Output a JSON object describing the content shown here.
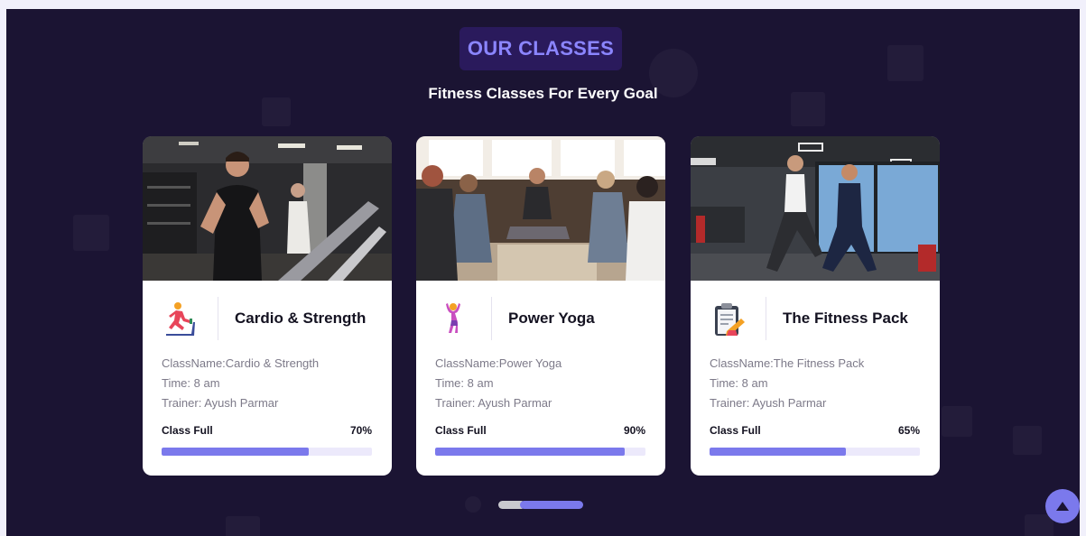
{
  "section": {
    "badge": "OUR CLASSES",
    "subtitle": "Fitness Classes For Every Goal"
  },
  "cards": [
    {
      "title": "Cardio & Strength",
      "icon": "treadmill-runner-icon",
      "class_name": "ClassName:Cardio & Strength",
      "time": "Time: 8 am",
      "trainer": "Trainer: Ayush Parmar",
      "full_label": "Class Full",
      "percent_label": "70%",
      "fill": 0.7
    },
    {
      "title": "Power Yoga",
      "icon": "yoga-pose-icon",
      "class_name": "ClassName:Power Yoga",
      "time": "Time: 8 am",
      "trainer": "Trainer: Ayush Parmar",
      "full_label": "Class Full",
      "percent_label": "90%",
      "fill": 0.9
    },
    {
      "title": "The Fitness Pack",
      "icon": "clipboard-plan-icon",
      "class_name": "ClassName:The Fitness Pack",
      "time": "Time: 8 am",
      "trainer": "Trainer: Ayush Parmar",
      "full_label": "Class Full",
      "percent_label": "65%",
      "fill": 0.65
    }
  ],
  "colors": {
    "background": "#1b1433",
    "accent": "#7b79ec",
    "badge_bg": "#2a1a5c",
    "badge_text": "#8b85ff"
  },
  "controls": {
    "scroll_top_icon": "arrow-up-icon",
    "pager_icon": "slider-pagination"
  }
}
